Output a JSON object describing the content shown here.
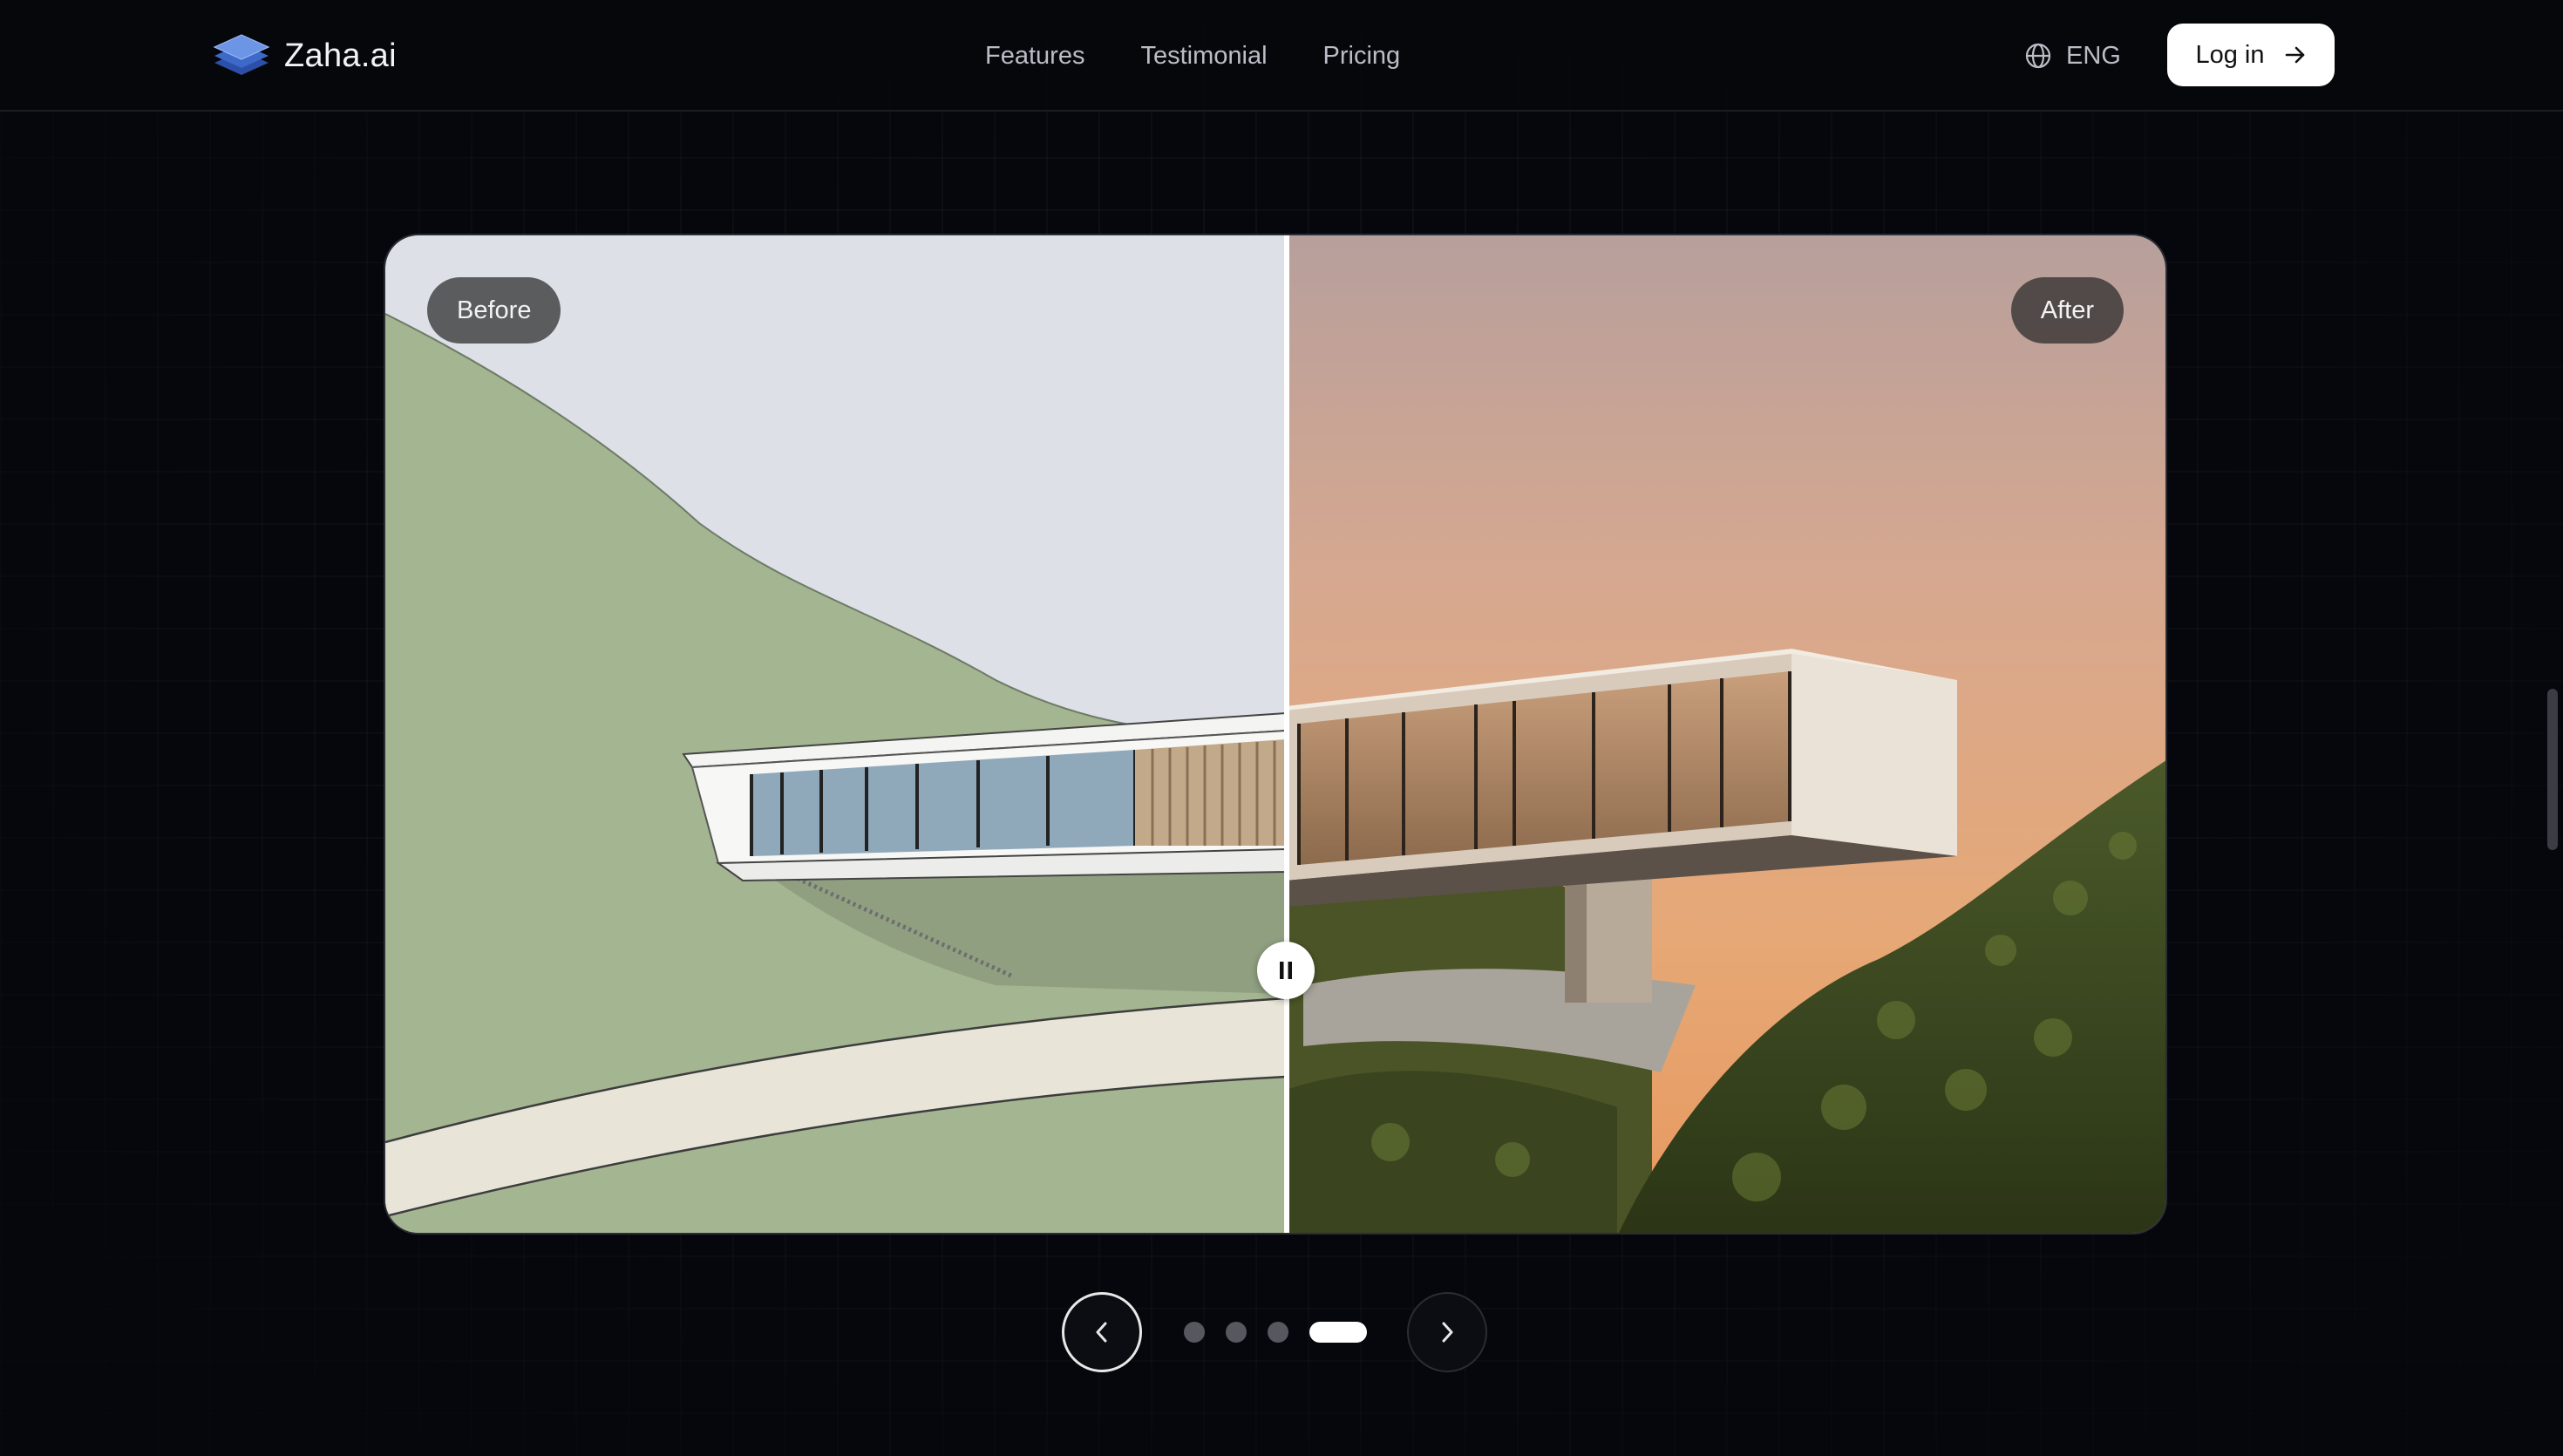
{
  "brand": {
    "name": "Zaha.ai",
    "logo_icon": "layers-logo-icon",
    "accent": "#4f7bd9"
  },
  "nav": {
    "links": [
      {
        "label": "Features"
      },
      {
        "label": "Testimonial"
      },
      {
        "label": "Pricing"
      }
    ]
  },
  "language": {
    "label": "ENG",
    "icon": "globe-icon"
  },
  "login": {
    "label": "Log in",
    "icon": "arrow-right-icon"
  },
  "compare": {
    "before_label": "Before",
    "after_label": "After",
    "handle_icon": "pause-icon",
    "split_position_pct": 50.5
  },
  "carousel": {
    "prev_icon": "chevron-left-icon",
    "next_icon": "chevron-right-icon",
    "slide_count": 4,
    "active_index": 3
  }
}
